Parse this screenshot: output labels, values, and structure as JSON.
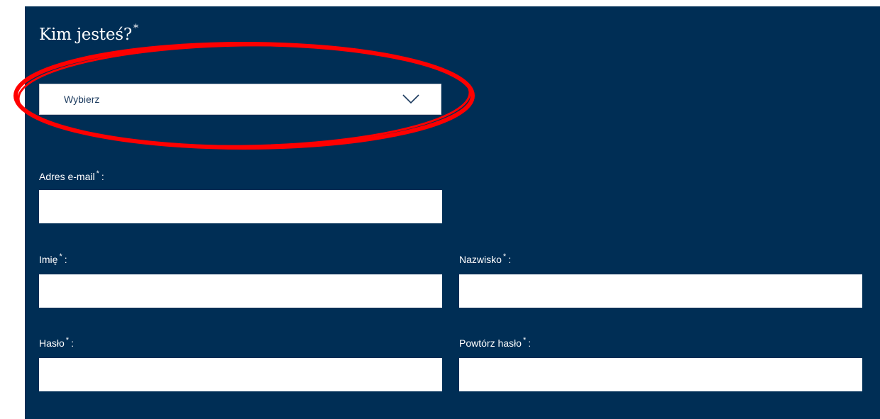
{
  "form": {
    "who_label": "Kim jesteś?",
    "required_mark": "*",
    "colon": ":",
    "select_value": "Wybierz",
    "fields": {
      "email_label": "Adres e-mail",
      "first_name_label": "Imię",
      "last_name_label": "Nazwisko",
      "password_label": "Hasło",
      "password_repeat_label": "Powtórz hasło"
    }
  },
  "colors": {
    "panel_background": "#002e55",
    "field_background": "#ffffff",
    "annotation_stroke": "#ff0000"
  },
  "icons": {
    "select_arrow": "chevron-down-icon"
  }
}
